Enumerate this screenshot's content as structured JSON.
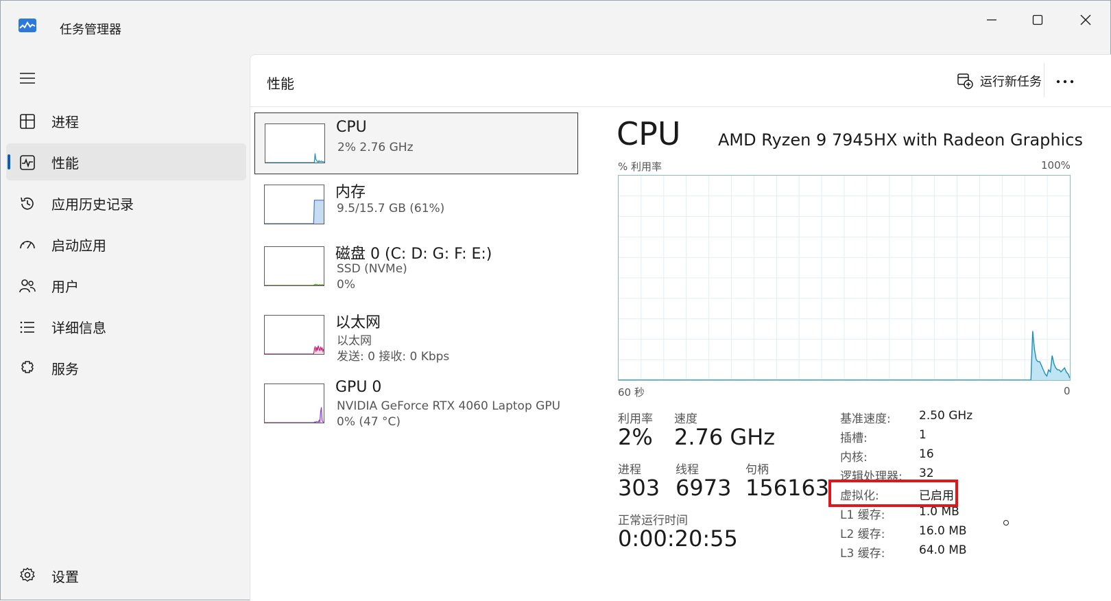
{
  "window": {
    "title": "任务管理器",
    "controls": {
      "minimize": "minimize-icon",
      "maximize": "maximize-icon",
      "close": "close-icon"
    }
  },
  "sidebar": {
    "items": [
      {
        "label": "进程",
        "icon": "processes-icon",
        "active": false
      },
      {
        "label": "性能",
        "icon": "performance-icon",
        "active": true
      },
      {
        "label": "应用历史记录",
        "icon": "app-history-icon",
        "active": false
      },
      {
        "label": "启动应用",
        "icon": "startup-apps-icon",
        "active": false
      },
      {
        "label": "用户",
        "icon": "users-icon",
        "active": false
      },
      {
        "label": "详细信息",
        "icon": "details-icon",
        "active": false
      },
      {
        "label": "服务",
        "icon": "services-icon",
        "active": false
      }
    ],
    "settings_label": "设置"
  },
  "header": {
    "title": "性能",
    "run_new_task": "运行新任务"
  },
  "devices": [
    {
      "name": "CPU",
      "lines": [
        "2%  2.76 GHz"
      ],
      "color": "#1b8fb6",
      "fill": "#d6eef8",
      "selected": true,
      "graph": "spike",
      "history": [
        0,
        0,
        0,
        0,
        0,
        0,
        0,
        0,
        0,
        0,
        0,
        0,
        0,
        0,
        0,
        0,
        0,
        0,
        0,
        0,
        0,
        0,
        0,
        0,
        0,
        0,
        0,
        0,
        0,
        0,
        0,
        0,
        0,
        0,
        0,
        0,
        0,
        0,
        0,
        0,
        0,
        0,
        0,
        0,
        0,
        0,
        0,
        0,
        0,
        0,
        0,
        0,
        0,
        0,
        0,
        0,
        0,
        0,
        0,
        0,
        0,
        0,
        0,
        0,
        24,
        8,
        6,
        3,
        1,
        5,
        2,
        3,
        4,
        2,
        3,
        2,
        1
      ]
    },
    {
      "name": "内存",
      "lines": [
        "9.5/15.7 GB (61%)"
      ],
      "color": "#3a78c4",
      "fill": "#c6dcf2",
      "selected": false,
      "graph": "step",
      "history": [
        0,
        0,
        0,
        0,
        0,
        0,
        0,
        0,
        0,
        0,
        0,
        0,
        0,
        0,
        0,
        0,
        0,
        0,
        0,
        0,
        0,
        0,
        0,
        0,
        0,
        0,
        0,
        0,
        0,
        0,
        0,
        0,
        0,
        0,
        0,
        0,
        0,
        0,
        0,
        0,
        0,
        0,
        0,
        0,
        0,
        0,
        0,
        0,
        0,
        0,
        0,
        0,
        0,
        0,
        0,
        0,
        0,
        0,
        0,
        0,
        0,
        0,
        0,
        0,
        61,
        61,
        61,
        61,
        61,
        61,
        61,
        61,
        61,
        61,
        61,
        61,
        61
      ]
    },
    {
      "name": "磁盘 0 (C: D: G: F: E:)",
      "lines": [
        "SSD (NVMe)",
        "0%"
      ],
      "color": "#4d8a12",
      "fill": "#e3f1d4",
      "selected": false,
      "graph": "flat",
      "history": [
        0,
        0,
        0,
        0,
        0,
        0,
        0,
        0,
        0,
        0,
        0,
        0,
        0,
        0,
        0,
        0,
        0,
        0,
        0,
        0,
        0,
        0,
        0,
        0,
        0,
        0,
        0,
        0,
        0,
        0,
        0,
        0,
        0,
        0,
        0,
        0,
        0,
        0,
        0,
        0,
        0,
        0,
        0,
        0,
        0,
        0,
        0,
        0,
        0,
        0,
        0,
        0,
        0,
        0,
        0,
        0,
        0,
        0,
        0,
        0,
        0,
        0,
        0,
        0,
        2,
        1,
        3,
        1,
        2,
        1,
        1,
        2,
        1,
        1,
        2,
        1,
        1
      ]
    },
    {
      "name": "以太网",
      "lines": [
        "以太网",
        "发送: 0 接收: 0 Kbps"
      ],
      "color": "#c2277a",
      "fill": "#f6d9e8",
      "selected": false,
      "graph": "noise",
      "history": [
        0,
        0,
        0,
        0,
        0,
        0,
        0,
        0,
        0,
        0,
        0,
        0,
        0,
        0,
        0,
        0,
        0,
        0,
        0,
        0,
        0,
        0,
        0,
        0,
        0,
        0,
        0,
        0,
        0,
        0,
        0,
        0,
        0,
        0,
        0,
        0,
        0,
        0,
        0,
        0,
        0,
        0,
        0,
        0,
        0,
        0,
        0,
        0,
        0,
        0,
        0,
        0,
        0,
        0,
        0,
        0,
        0,
        0,
        0,
        0,
        0,
        0,
        0,
        0,
        12,
        20,
        6,
        18,
        9,
        22,
        14,
        8,
        19,
        11,
        16,
        7,
        13
      ]
    },
    {
      "name": "GPU 0",
      "lines": [
        "NVIDIA GeForce RTX 4060 Laptop GPU",
        "0%  (47 °C)"
      ],
      "color": "#8c3fc9",
      "fill": "#ead9f6",
      "selected": false,
      "graph": "spike2",
      "history": [
        0,
        0,
        0,
        0,
        0,
        0,
        0,
        0,
        0,
        0,
        0,
        0,
        0,
        0,
        0,
        0,
        0,
        0,
        0,
        0,
        0,
        0,
        0,
        0,
        0,
        0,
        0,
        0,
        0,
        0,
        0,
        0,
        0,
        0,
        0,
        0,
        0,
        0,
        0,
        0,
        0,
        0,
        0,
        0,
        0,
        0,
        0,
        0,
        0,
        0,
        0,
        0,
        0,
        0,
        0,
        0,
        0,
        0,
        0,
        0,
        0,
        0,
        0,
        0,
        1,
        2,
        1,
        3,
        2,
        1,
        6,
        2,
        28,
        40,
        6,
        2,
        1
      ]
    }
  ],
  "detail": {
    "title": "CPU",
    "model": "AMD Ryzen 9 7945HX with Radeon Graphics",
    "graph": {
      "y_label": "% 利用率",
      "y_max_label": "100%",
      "x_left_label": "60 秒",
      "x_right_label": "0",
      "line_color": "#1b8fb6",
      "fill_color": "#bfe4f3",
      "grid_color": "#e3eef3",
      "history": [
        0,
        0,
        0,
        0,
        0,
        0,
        0,
        0,
        0,
        0,
        0,
        0,
        0,
        0,
        0,
        0,
        0,
        0,
        0,
        0,
        0,
        0,
        0,
        0,
        0,
        0,
        0,
        0,
        0,
        0,
        0,
        0,
        0,
        0,
        0,
        0,
        0,
        0,
        0,
        0,
        0,
        0,
        0,
        0,
        0,
        0,
        0,
        0,
        0,
        0,
        0,
        0,
        0,
        0,
        0,
        0,
        0,
        0,
        0,
        0,
        0,
        0,
        0,
        0,
        0,
        0,
        0,
        0,
        0,
        0,
        0,
        0,
        0,
        0,
        0,
        0,
        0,
        0,
        0,
        0,
        0,
        0,
        0,
        0,
        0,
        0,
        0,
        0,
        0,
        0,
        0,
        0,
        0,
        0,
        0,
        0,
        0,
        0,
        0,
        0,
        0,
        0,
        0,
        0,
        0,
        0,
        0,
        0,
        0,
        0,
        0,
        0,
        0,
        0,
        0,
        0,
        0,
        0,
        0,
        0,
        0,
        0,
        0,
        0,
        0,
        0,
        0,
        0,
        0,
        0,
        0,
        0,
        0,
        0,
        0,
        0,
        0,
        0,
        0,
        0,
        0,
        0,
        0,
        0,
        0,
        0,
        0,
        0,
        0,
        0,
        0,
        0,
        0,
        0,
        0,
        0,
        0,
        0,
        0,
        0,
        0,
        0,
        0,
        0,
        0,
        0,
        0,
        0,
        0,
        0,
        0,
        0,
        0,
        0,
        0,
        0,
        0,
        0,
        0,
        0,
        0,
        0,
        0,
        0,
        0,
        0,
        0,
        0,
        0,
        0,
        0,
        0,
        0,
        0,
        0,
        0,
        0,
        0,
        0,
        0,
        0,
        0,
        0,
        0,
        0,
        0,
        0,
        0,
        0,
        0,
        0,
        0,
        0,
        0,
        0,
        0,
        0,
        0,
        0,
        0,
        0,
        0,
        0,
        0,
        0,
        0,
        0,
        0,
        0,
        0,
        0,
        0,
        0,
        0,
        24,
        15,
        10,
        9,
        9,
        7,
        5,
        3,
        2,
        5,
        4,
        12,
        8,
        6,
        5,
        5,
        4,
        5,
        6,
        4,
        3,
        1
      ]
    },
    "stats": {
      "utilization": {
        "label": "利用率",
        "value": "2%"
      },
      "speed": {
        "label": "速度",
        "value": "2.76 GHz"
      },
      "processes": {
        "label": "进程",
        "value": "303"
      },
      "threads": {
        "label": "线程",
        "value": "6973"
      },
      "handles": {
        "label": "句柄",
        "value": "156163"
      },
      "uptime": {
        "label": "正常运行时间",
        "value": "0:00:20:55"
      }
    },
    "specs": [
      {
        "label": "基准速度:",
        "value": "2.50 GHz"
      },
      {
        "label": "插槽:",
        "value": "1"
      },
      {
        "label": "内核:",
        "value": "16"
      },
      {
        "label": "逻辑处理器:",
        "value": "32"
      },
      {
        "label": "虚拟化:",
        "value": "已启用"
      },
      {
        "label": "L1 缓存:",
        "value": "1.0 MB"
      },
      {
        "label": "L2 缓存:",
        "value": "16.0 MB"
      },
      {
        "label": "L3 缓存:",
        "value": "64.0 MB"
      }
    ],
    "highlight_color": "#e0161b"
  }
}
